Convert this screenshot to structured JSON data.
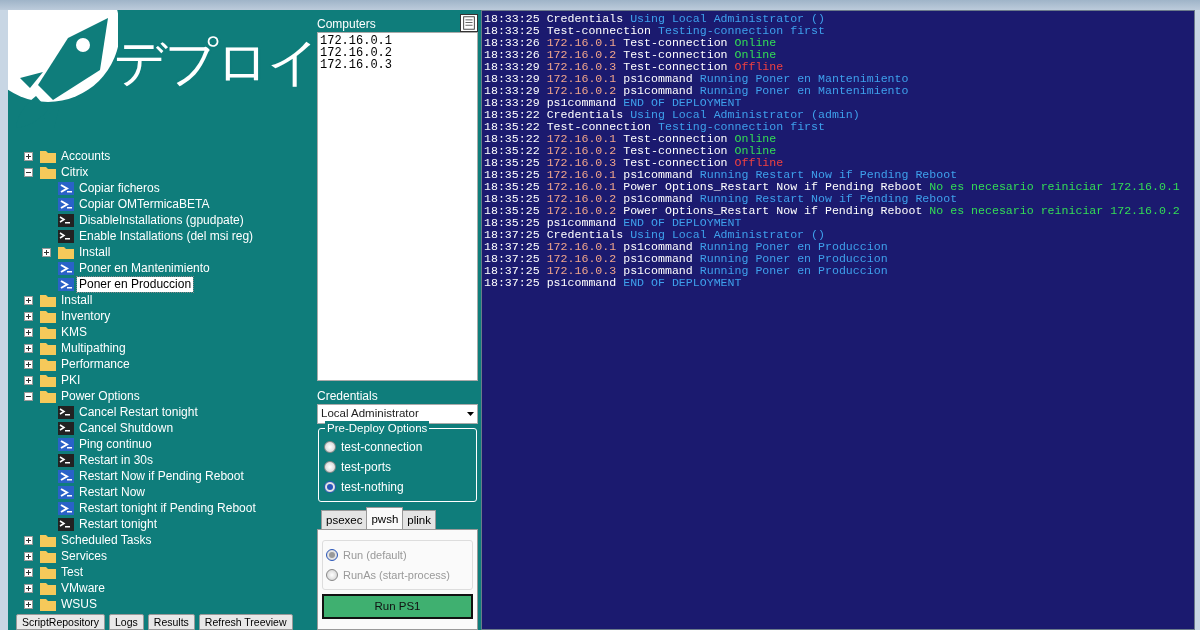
{
  "logo": {
    "text": "デプロイ"
  },
  "tree": [
    {
      "label": "Accounts",
      "kind": "folder",
      "expanded": false,
      "selected": false
    },
    {
      "label": "Citrix",
      "kind": "folder",
      "expanded": true,
      "selected": false,
      "children": [
        {
          "label": "Copiar ficheros",
          "kind": "ps",
          "selected": false
        },
        {
          "label": "Copiar OMTermicaBETA",
          "kind": "ps",
          "selected": false
        },
        {
          "label": "DisableInstallations (gpudpate)",
          "kind": "cmd",
          "selected": false
        },
        {
          "label": "Enable Installations (del msi reg)",
          "kind": "cmd",
          "selected": false
        },
        {
          "label": "Install",
          "kind": "folder",
          "expanded": false,
          "selected": false
        },
        {
          "label": "Poner en Mantenimiento",
          "kind": "ps",
          "selected": false
        },
        {
          "label": "Poner en Produccion",
          "kind": "ps",
          "selected": true
        }
      ]
    },
    {
      "label": "Install",
      "kind": "folder",
      "expanded": false,
      "selected": false
    },
    {
      "label": "Inventory",
      "kind": "folder",
      "expanded": false,
      "selected": false
    },
    {
      "label": "KMS",
      "kind": "folder",
      "expanded": false,
      "selected": false
    },
    {
      "label": "Multipathing",
      "kind": "folder",
      "expanded": false,
      "selected": false
    },
    {
      "label": "Performance",
      "kind": "folder",
      "expanded": false,
      "selected": false
    },
    {
      "label": "PKI",
      "kind": "folder",
      "expanded": false,
      "selected": false
    },
    {
      "label": "Power Options",
      "kind": "folder",
      "expanded": true,
      "selected": false,
      "children": [
        {
          "label": "Cancel Restart tonight",
          "kind": "cmd",
          "selected": false
        },
        {
          "label": "Cancel Shutdown",
          "kind": "cmd",
          "selected": false
        },
        {
          "label": "Ping continuo",
          "kind": "ps",
          "selected": false
        },
        {
          "label": "Restart in 30s",
          "kind": "cmd",
          "selected": false
        },
        {
          "label": "Restart Now if Pending Reboot",
          "kind": "ps",
          "selected": false
        },
        {
          "label": "Restart Now",
          "kind": "ps",
          "selected": false
        },
        {
          "label": "Restart tonight if Pending Reboot",
          "kind": "ps",
          "selected": false
        },
        {
          "label": "Restart tonight",
          "kind": "cmd",
          "selected": false
        }
      ]
    },
    {
      "label": "Scheduled Tasks",
      "kind": "folder",
      "expanded": false,
      "selected": false
    },
    {
      "label": "Services",
      "kind": "folder",
      "expanded": false,
      "selected": false
    },
    {
      "label": "Test",
      "kind": "folder",
      "expanded": false,
      "selected": false
    },
    {
      "label": "VMware",
      "kind": "folder",
      "expanded": false,
      "selected": false
    },
    {
      "label": "WSUS",
      "kind": "folder",
      "expanded": false,
      "selected": false
    }
  ],
  "bottom_buttons": [
    "ScriptRepository",
    "Logs",
    "Results",
    "Refresh Treeview"
  ],
  "computers": {
    "label": "Computers",
    "lines": [
      "172.16.0.1",
      "172.16.0.2",
      "172.16.0.3"
    ]
  },
  "credentials": {
    "label": "Credentials",
    "value": "Local Administrator"
  },
  "pre_deploy": {
    "title": "Pre-Deploy Options",
    "options": [
      {
        "label": "test-connection",
        "selected": false
      },
      {
        "label": "test-ports",
        "selected": false
      },
      {
        "label": "test-nothing",
        "selected": true
      }
    ]
  },
  "tabs": [
    {
      "label": "psexec",
      "selected": false
    },
    {
      "label": "pwsh",
      "selected": true
    },
    {
      "label": "plink",
      "selected": false
    }
  ],
  "run_options": [
    {
      "label": "Run (default)",
      "selected": true,
      "disabled": true
    },
    {
      "label": "RunAs (start-process)",
      "selected": false,
      "disabled": true
    }
  ],
  "run_button": "Run PS1",
  "log": [
    {
      "segments": [
        {
          "kind": "time",
          "text": "18:33:25"
        },
        {
          "kind": "source",
          "text": "Credentials"
        },
        {
          "kind": "info",
          "text": "Using Local Administrator ()"
        }
      ]
    },
    {
      "segments": [
        {
          "kind": "time",
          "text": "18:33:25"
        },
        {
          "kind": "source",
          "text": "Test-connection"
        },
        {
          "kind": "info",
          "text": "Testing-connection first"
        }
      ]
    },
    {
      "segments": [
        {
          "kind": "time",
          "text": "18:33:26"
        },
        {
          "kind": "ip",
          "text": "172.16.0.1"
        },
        {
          "kind": "source",
          "text": "Test-connection"
        },
        {
          "kind": "ok",
          "text": "Online"
        }
      ]
    },
    {
      "segments": [
        {
          "kind": "time",
          "text": "18:33:26"
        },
        {
          "kind": "ip",
          "text": "172.16.0.2"
        },
        {
          "kind": "source",
          "text": "Test-connection"
        },
        {
          "kind": "ok",
          "text": "Online"
        }
      ]
    },
    {
      "segments": [
        {
          "kind": "time",
          "text": "18:33:29"
        },
        {
          "kind": "ip",
          "text": "172.16.0.3"
        },
        {
          "kind": "source",
          "text": "Test-connection"
        },
        {
          "kind": "error",
          "text": "Offline"
        }
      ]
    },
    {
      "segments": [
        {
          "kind": "time",
          "text": "18:33:29"
        },
        {
          "kind": "ip",
          "text": "172.16.0.1"
        },
        {
          "kind": "source",
          "text": "ps1command"
        },
        {
          "kind": "info",
          "text": "Running Poner en Mantenimiento"
        }
      ]
    },
    {
      "segments": [
        {
          "kind": "time",
          "text": "18:33:29"
        },
        {
          "kind": "ip",
          "text": "172.16.0.2"
        },
        {
          "kind": "source",
          "text": "ps1command"
        },
        {
          "kind": "info",
          "text": "Running Poner en Mantenimiento"
        }
      ]
    },
    {
      "segments": [
        {
          "kind": "time",
          "text": "18:33:29"
        },
        {
          "kind": "source",
          "text": "ps1command"
        },
        {
          "kind": "info",
          "text": "END OF DEPLOYMENT"
        }
      ]
    },
    {
      "segments": [
        {
          "kind": "time",
          "text": "18:35:22"
        },
        {
          "kind": "source",
          "text": "Credentials"
        },
        {
          "kind": "info",
          "text": "Using Local Administrator (admin)"
        }
      ]
    },
    {
      "segments": [
        {
          "kind": "time",
          "text": "18:35:22"
        },
        {
          "kind": "source",
          "text": "Test-connection"
        },
        {
          "kind": "info",
          "text": "Testing-connection first"
        }
      ]
    },
    {
      "segments": [
        {
          "kind": "time",
          "text": "18:35:22"
        },
        {
          "kind": "ip",
          "text": "172.16.0.1"
        },
        {
          "kind": "source",
          "text": "Test-connection"
        },
        {
          "kind": "ok",
          "text": "Online"
        }
      ]
    },
    {
      "segments": [
        {
          "kind": "time",
          "text": "18:35:22"
        },
        {
          "kind": "ip",
          "text": "172.16.0.2"
        },
        {
          "kind": "source",
          "text": "Test-connection"
        },
        {
          "kind": "ok",
          "text": "Online"
        }
      ]
    },
    {
      "segments": [
        {
          "kind": "time",
          "text": "18:35:25"
        },
        {
          "kind": "ip",
          "text": "172.16.0.3"
        },
        {
          "kind": "source",
          "text": "Test-connection"
        },
        {
          "kind": "error",
          "text": "Offline"
        }
      ]
    },
    {
      "segments": [
        {
          "kind": "time",
          "text": "18:35:25"
        },
        {
          "kind": "ip",
          "text": "172.16.0.1"
        },
        {
          "kind": "source",
          "text": "ps1command"
        },
        {
          "kind": "info",
          "text": "Running Restart Now if Pending Reboot"
        }
      ]
    },
    {
      "segments": [
        {
          "kind": "time",
          "text": "18:35:25"
        },
        {
          "kind": "ip",
          "text": "172.16.0.1"
        },
        {
          "kind": "source",
          "text": "Power Options_Restart Now if Pending Reboot"
        },
        {
          "kind": "ok",
          "text": "No es necesario reiniciar 172.16.0.1"
        }
      ]
    },
    {
      "segments": [
        {
          "kind": "time",
          "text": "18:35:25"
        },
        {
          "kind": "ip",
          "text": "172.16.0.2"
        },
        {
          "kind": "source",
          "text": "ps1command"
        },
        {
          "kind": "info",
          "text": "Running Restart Now if Pending Reboot"
        }
      ]
    },
    {
      "segments": [
        {
          "kind": "time",
          "text": "18:35:25"
        },
        {
          "kind": "ip",
          "text": "172.16.0.2"
        },
        {
          "kind": "source",
          "text": "Power Options_Restart Now if Pending Reboot"
        },
        {
          "kind": "ok",
          "text": "No es necesario reiniciar 172.16.0.2"
        }
      ]
    },
    {
      "segments": [
        {
          "kind": "time",
          "text": "18:35:25"
        },
        {
          "kind": "source",
          "text": "ps1command"
        },
        {
          "kind": "info",
          "text": "END OF DEPLOYMENT"
        }
      ]
    },
    {
      "segments": [
        {
          "kind": "time",
          "text": "18:37:25"
        },
        {
          "kind": "source",
          "text": "Credentials"
        },
        {
          "kind": "info",
          "text": "Using Local Administrator ()"
        }
      ]
    },
    {
      "segments": [
        {
          "kind": "time",
          "text": "18:37:25"
        },
        {
          "kind": "ip",
          "text": "172.16.0.1"
        },
        {
          "kind": "source",
          "text": "ps1command"
        },
        {
          "kind": "info",
          "text": "Running Poner en Produccion"
        }
      ]
    },
    {
      "segments": [
        {
          "kind": "time",
          "text": "18:37:25"
        },
        {
          "kind": "ip",
          "text": "172.16.0.2"
        },
        {
          "kind": "source",
          "text": "ps1command"
        },
        {
          "kind": "info",
          "text": "Running Poner en Produccion"
        }
      ]
    },
    {
      "segments": [
        {
          "kind": "time",
          "text": "18:37:25"
        },
        {
          "kind": "ip",
          "text": "172.16.0.3"
        },
        {
          "kind": "source",
          "text": "ps1command"
        },
        {
          "kind": "info",
          "text": "Running Poner en Produccion"
        }
      ]
    },
    {
      "segments": [
        {
          "kind": "time",
          "text": "18:37:25"
        },
        {
          "kind": "source",
          "text": "ps1command"
        },
        {
          "kind": "info",
          "text": "END OF DEPLOYMENT"
        }
      ]
    }
  ]
}
